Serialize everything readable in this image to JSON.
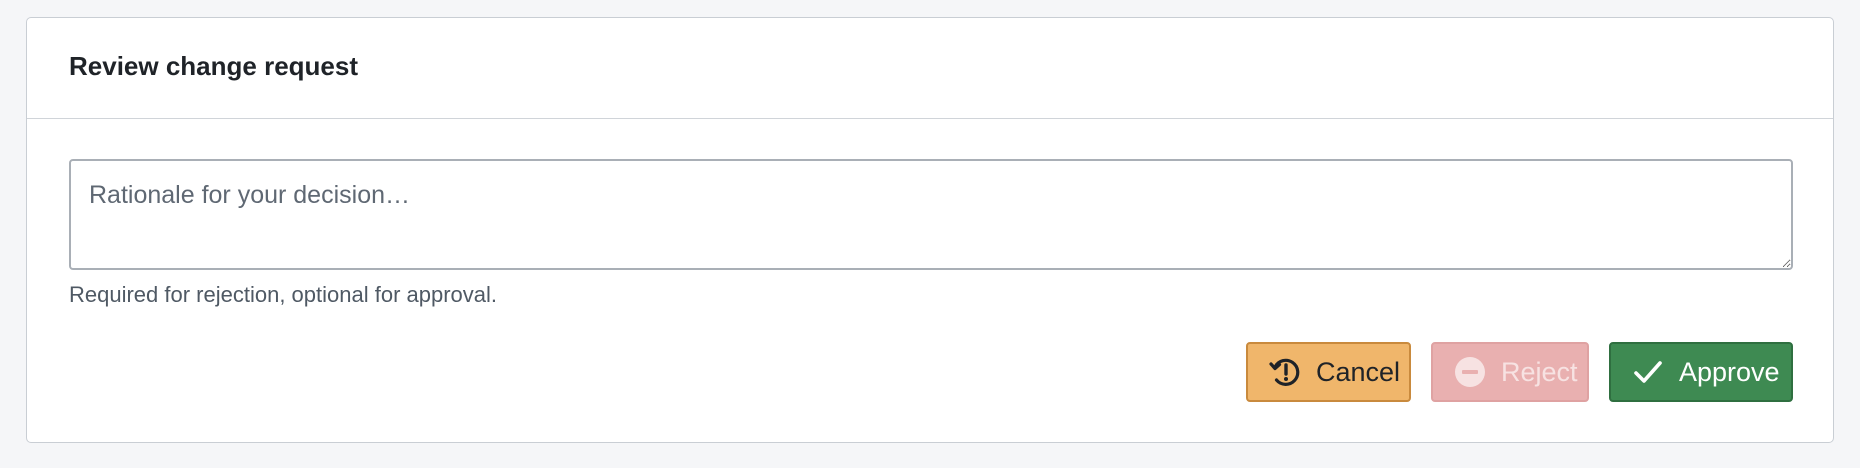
{
  "card": {
    "title": "Review change request"
  },
  "rationale": {
    "value": "",
    "placeholder": "Rationale for your decision…",
    "help_text": "Required for rejection, optional for approval."
  },
  "actions": {
    "cancel": {
      "label": "Cancel",
      "icon": "history-alert-icon",
      "color": "#f0b66b",
      "disabled": false
    },
    "reject": {
      "label": "Reject",
      "icon": "minus-circle-icon",
      "color": "#e9b0b0",
      "disabled": true
    },
    "approve": {
      "label": "Approve",
      "icon": "check-icon",
      "color": "#3e8a52",
      "disabled": false
    }
  }
}
